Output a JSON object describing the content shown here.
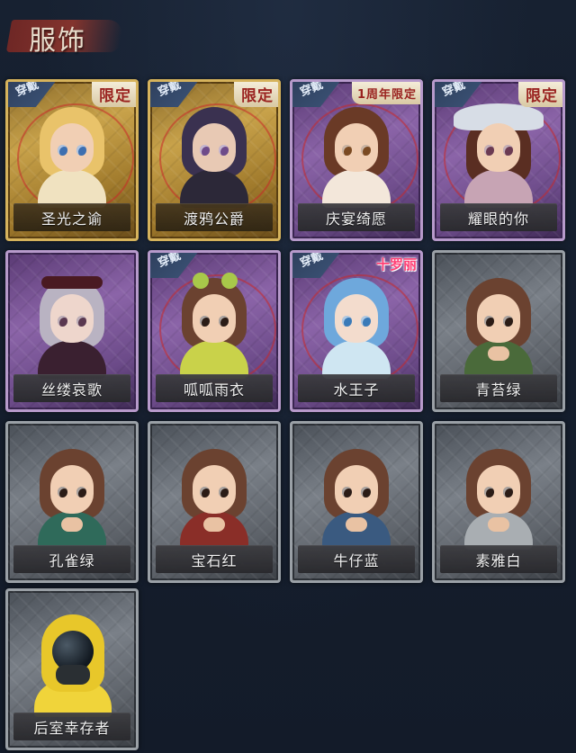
{
  "header": {
    "title": "服饰"
  },
  "badges": {
    "worn": "穿戴",
    "limited": "限定",
    "anniversary": "1周年限定",
    "brand": "十罗丽"
  },
  "colors": {
    "background": "#131b29",
    "gold_frame": "#d6b35c",
    "purple_frame": "#b79acb",
    "grey_frame": "#9aa0a6",
    "limited_text": "#9a2320"
  },
  "items": [
    {
      "name": "圣光之谕",
      "rarity": "gold",
      "worn": true,
      "tag": "限定"
    },
    {
      "name": "渡鸦公爵",
      "rarity": "gold",
      "worn": true,
      "tag": "限定"
    },
    {
      "name": "庆宴绮愿",
      "rarity": "purple",
      "worn": true,
      "tag": "1周年限定"
    },
    {
      "name": "耀眼的你",
      "rarity": "purple",
      "worn": true,
      "tag": "限定"
    },
    {
      "name": "丝缕哀歌",
      "rarity": "purple",
      "worn": false,
      "tag": ""
    },
    {
      "name": "呱呱雨衣",
      "rarity": "purple",
      "worn": true,
      "tag": ""
    },
    {
      "name": "水王子",
      "rarity": "purple",
      "worn": true,
      "tag": "十罗丽"
    },
    {
      "name": "青苔绿",
      "rarity": "grey",
      "worn": false,
      "tag": ""
    },
    {
      "name": "孔雀绿",
      "rarity": "grey",
      "worn": false,
      "tag": ""
    },
    {
      "name": "宝石红",
      "rarity": "grey",
      "worn": false,
      "tag": ""
    },
    {
      "name": "牛仔蓝",
      "rarity": "grey",
      "worn": false,
      "tag": ""
    },
    {
      "name": "素雅白",
      "rarity": "grey",
      "worn": false,
      "tag": ""
    },
    {
      "name": "后室幸存者",
      "rarity": "grey",
      "worn": false,
      "tag": ""
    }
  ]
}
